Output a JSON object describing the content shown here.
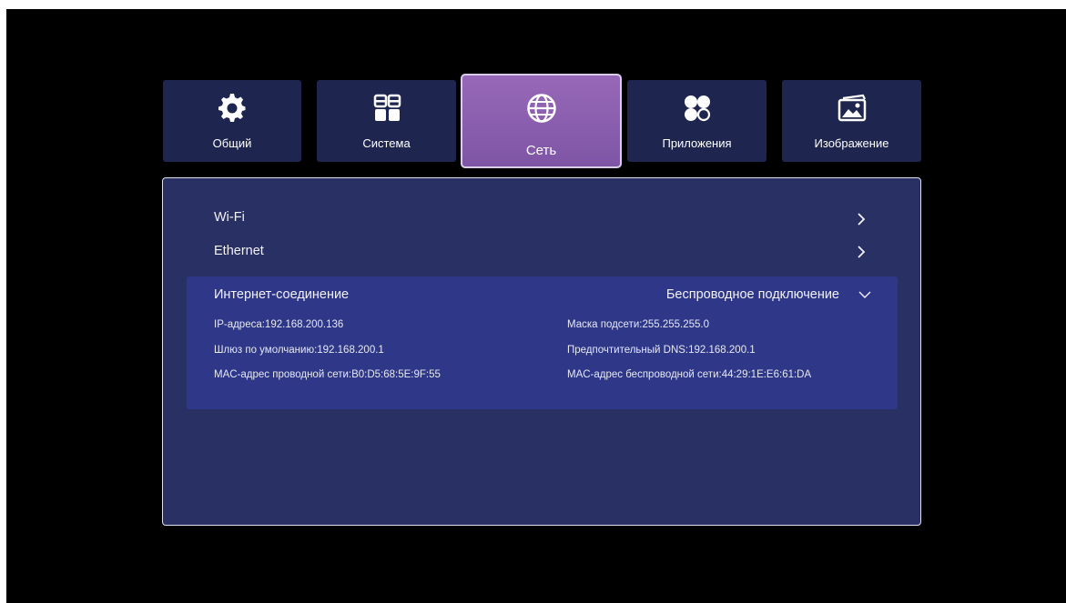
{
  "tabs": [
    {
      "label": "Общий",
      "icon": "gear-icon"
    },
    {
      "label": "Система",
      "icon": "system-grid-icon"
    },
    {
      "label": "Сеть",
      "icon": "globe-icon",
      "active": true
    },
    {
      "label": "Приложения",
      "icon": "apps-icon"
    },
    {
      "label": "Изображение",
      "icon": "picture-icon"
    }
  ],
  "network": {
    "wifi_label": "Wi-Fi",
    "ethernet_label": "Ethernet",
    "connection": {
      "title": "Интернет-соединение",
      "value": "Беспроводное подключение",
      "ip": "IP-адреса:192.168.200.136",
      "mask": "Маска подсети:255.255.255.0",
      "gateway": "Шлюз по умолчанию:192.168.200.1",
      "dns": "Предпочтительный DNS:192.168.200.1",
      "mac_wired": "MAC-адрес проводной сети:B0:D5:68:5E:9F:55",
      "mac_wireless": "MAC-адрес беспроводной сети:44:29:1E:E6:61:DA"
    }
  },
  "colors": {
    "background": "#000000",
    "tab": "#1e2650",
    "tab_active": "#8a5fb0",
    "panel": "#283064",
    "highlight": "#2f3888"
  }
}
